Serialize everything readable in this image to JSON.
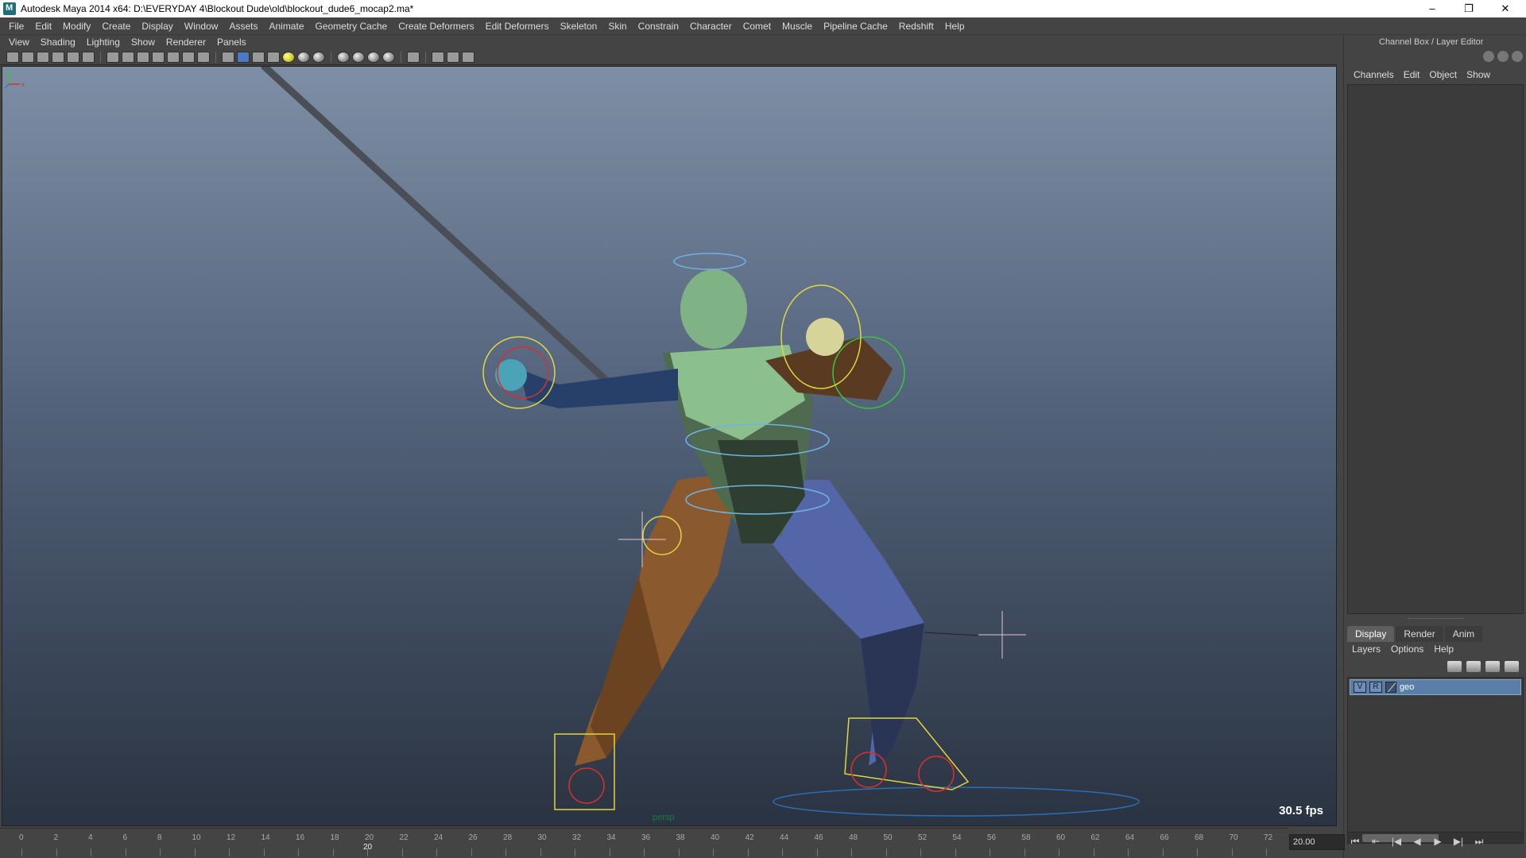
{
  "window": {
    "title": "Autodesk Maya 2014 x64: D:\\EVERYDAY 4\\Blockout Dude\\old\\blockout_dude6_mocap2.ma*",
    "minimize": "–",
    "maximize": "❐",
    "close": "✕"
  },
  "menubar": [
    "File",
    "Edit",
    "Modify",
    "Create",
    "Display",
    "Window",
    "Assets",
    "Animate",
    "Geometry Cache",
    "Create Deformers",
    "Edit Deformers",
    "Skeleton",
    "Skin",
    "Constrain",
    "Character",
    "Comet",
    "Muscle",
    "Pipeline Cache",
    "Redshift",
    "Help"
  ],
  "panel_menu": [
    "View",
    "Shading",
    "Lighting",
    "Show",
    "Renderer",
    "Panels"
  ],
  "viewport": {
    "fps": "30.5 fps",
    "camera": "persp",
    "axis_y": "y",
    "axis_x": "x"
  },
  "channel_box": {
    "title": "Channel Box / Layer Editor",
    "menu": [
      "Channels",
      "Edit",
      "Object",
      "Show"
    ]
  },
  "layer_editor": {
    "tabs": [
      "Display",
      "Render",
      "Anim"
    ],
    "active_tab": "Display",
    "menu": [
      "Layers",
      "Options",
      "Help"
    ],
    "layers": [
      {
        "v": "V",
        "r": "R",
        "name": "geo"
      }
    ]
  },
  "time_slider": {
    "ticks": [
      "0",
      "2",
      "4",
      "6",
      "8",
      "10",
      "12",
      "14",
      "16",
      "18",
      "20",
      "22",
      "24",
      "26",
      "28",
      "30",
      "32",
      "34",
      "36",
      "38",
      "40",
      "42",
      "44",
      "46",
      "48",
      "50",
      "52",
      "54",
      "56",
      "58",
      "60",
      "62",
      "64",
      "66",
      "68",
      "70",
      "72"
    ],
    "current_frame": "20",
    "current_field": "20.00"
  },
  "playback": {
    "go_start": "⏮",
    "step_back_key": "⇤",
    "step_back": "|◀",
    "play_back": "◀",
    "play_fwd": "▶",
    "step_fwd": "▶|",
    "go_end": "⏭"
  },
  "colors": {
    "viewport_top": "#7d8ea5",
    "viewport_bottom": "#2a3341",
    "layer_selected": "#5a7ea8"
  }
}
